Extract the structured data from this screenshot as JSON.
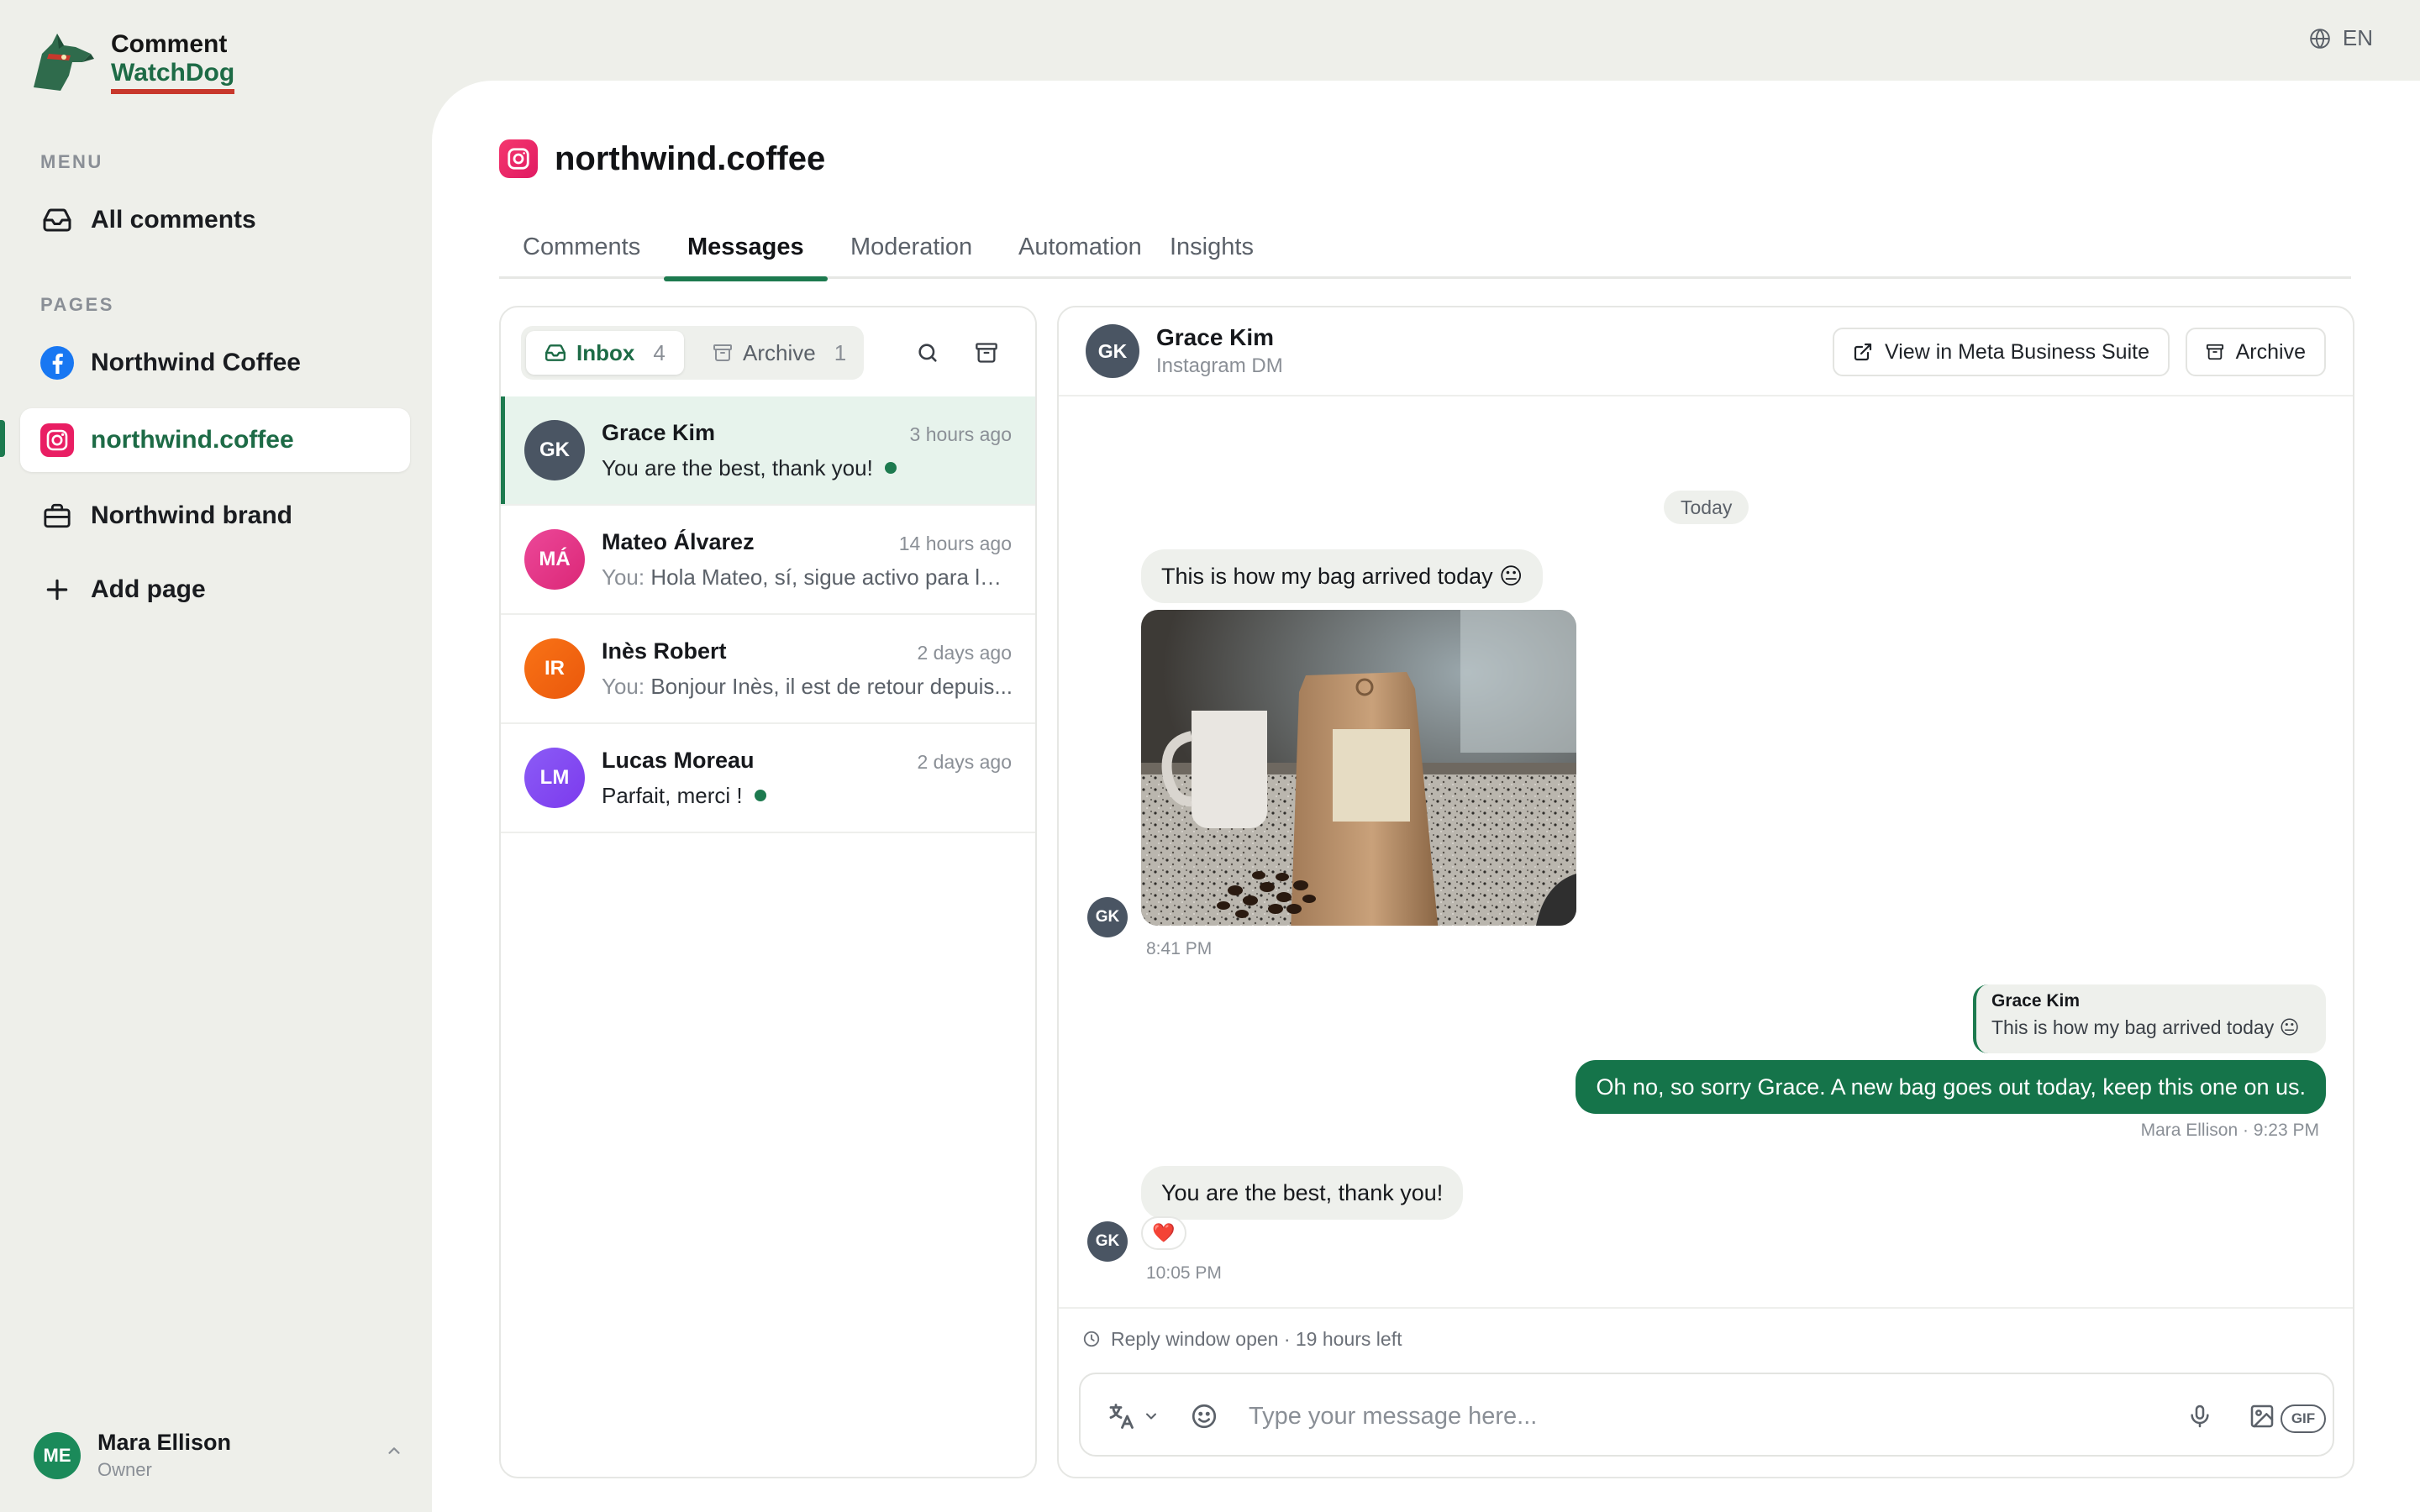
{
  "app": {
    "name_line1": "Comment",
    "name_line2": "WatchDog",
    "language": "EN"
  },
  "sidebar": {
    "menu_label": "MENU",
    "menu_items": [
      {
        "label": "All comments",
        "icon": "inbox-icon"
      }
    ],
    "pages_label": "PAGES",
    "pages": [
      {
        "label": "Northwind Coffee",
        "icon": "facebook-icon"
      },
      {
        "label": "northwind.coffee",
        "icon": "instagram-icon",
        "active": true
      },
      {
        "label": "Northwind brand",
        "icon": "briefcase-icon"
      },
      {
        "label": "Add page",
        "icon": "plus-icon"
      }
    ],
    "user": {
      "initials": "ME",
      "name": "Mara Ellison",
      "role": "Owner"
    }
  },
  "page": {
    "title": "northwind.coffee",
    "tabs": [
      "Comments",
      "Messages",
      "Moderation",
      "Automation",
      "Insights"
    ],
    "active_tab": "Messages"
  },
  "inbox": {
    "inbox_label": "Inbox",
    "inbox_count": "4",
    "archive_label": "Archive",
    "archive_count": "1",
    "conversations": [
      {
        "initials": "GK",
        "name": "Grace Kim",
        "time": "3 hours ago",
        "you_prefix": "",
        "preview": "You are the best, thank you!",
        "unread": true,
        "color": "#4a5563"
      },
      {
        "initials": "MÁ",
        "name": "Mateo Álvarez",
        "time": "14 hours ago",
        "you_prefix": "You:",
        "preview": "Hola Mateo, sí, sigue activo para la ...",
        "unread": false,
        "color": "#db2777"
      },
      {
        "initials": "IR",
        "name": "Inès Robert",
        "time": "2 days ago",
        "you_prefix": "You:",
        "preview": "Bonjour Inès, il est de retour depuis...",
        "unread": false,
        "color": "#ea580c"
      },
      {
        "initials": "LM",
        "name": "Lucas Moreau",
        "time": "2 days ago",
        "you_prefix": "",
        "preview": "Parfait, merci !",
        "unread": true,
        "color": "#7c3aed"
      }
    ]
  },
  "chat": {
    "contact_initials": "GK",
    "contact_name": "Grace Kim",
    "channel": "Instagram DM",
    "meta_button": "View in Meta Business Suite",
    "archive_button": "Archive",
    "date_divider": "Today",
    "messages": [
      {
        "text": "This is how my bag arrived today 😐"
      },
      {
        "time": "8:41 PM"
      },
      {
        "reply_to_name": "Grace Kim",
        "reply_to_text": "This is how my bag arrived today 😐",
        "text": "Oh no, so sorry Grace. A new bag goes out today, keep this one on us.",
        "meta": "Mara Ellison · 9:23 PM"
      },
      {
        "text": "You are the best, thank you!",
        "reaction": "❤️",
        "time": "10:05 PM"
      }
    ],
    "reply_window": "Reply window open · 19 hours left",
    "composer_placeholder": "Type your message here...",
    "gif_label": "GIF"
  },
  "colors": {
    "brand_green": "#1d7a4f",
    "outgoing_bubble": "#15744a",
    "incoming_bubble": "#eef0ec",
    "instagram": "#e91e63",
    "facebook": "#1877f2"
  }
}
